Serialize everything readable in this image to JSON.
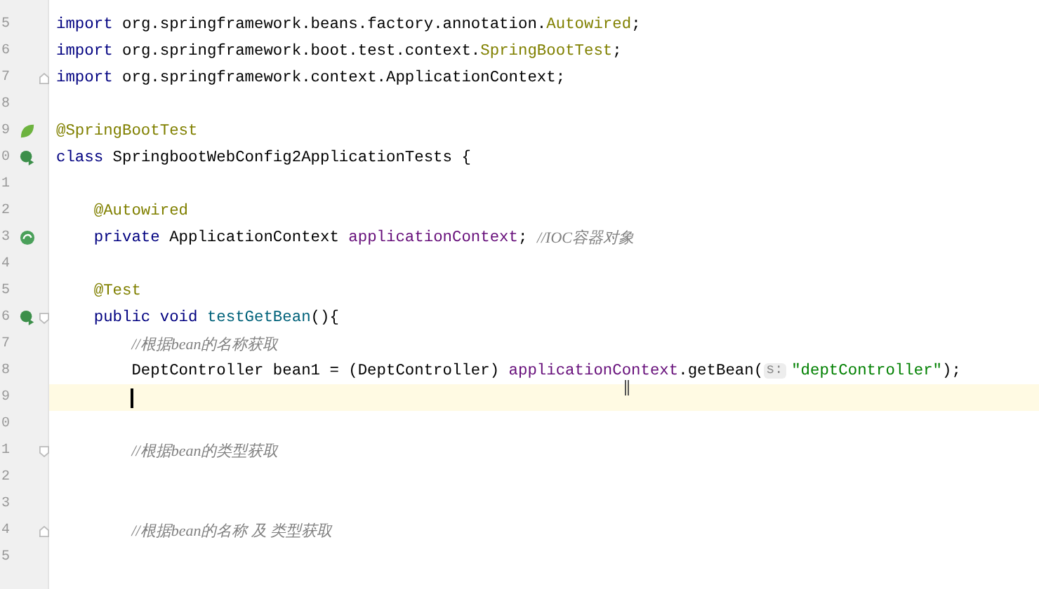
{
  "editor": {
    "lines": [
      {
        "number": "5",
        "tokens": [
          {
            "kind": "keyword",
            "text": "import"
          },
          {
            "kind": "plain",
            "text": " org.springframework.beans.factory.annotation."
          },
          {
            "kind": "annotation",
            "text": "Autowired"
          },
          {
            "kind": "plain",
            "text": ";"
          }
        ]
      },
      {
        "number": "6",
        "tokens": [
          {
            "kind": "keyword",
            "text": "import"
          },
          {
            "kind": "plain",
            "text": " org.springframework.boot.test.context."
          },
          {
            "kind": "annotation",
            "text": "SpringBootTest"
          },
          {
            "kind": "plain",
            "text": ";"
          }
        ]
      },
      {
        "number": "7",
        "fold": {
          "kind": "end"
        },
        "tokens": [
          {
            "kind": "keyword",
            "text": "import"
          },
          {
            "kind": "plain",
            "text": " org.springframework.context.ApplicationContext;"
          }
        ]
      },
      {
        "number": "8"
      },
      {
        "number": "9",
        "gutter_icon": {
          "kind": "leaf"
        },
        "tokens": [
          {
            "kind": "annotation",
            "text": "@SpringBootTest"
          }
        ]
      },
      {
        "number": "0",
        "gutter_icon": {
          "kind": "run"
        },
        "tokens": [
          {
            "kind": "keyword",
            "text": "class"
          },
          {
            "kind": "plain",
            "text": " SpringbootWebConfig2ApplicationTests {"
          }
        ]
      },
      {
        "number": "1"
      },
      {
        "number": "2",
        "tokens": [
          {
            "kind": "annotation",
            "text": "    @Autowired"
          }
        ]
      },
      {
        "number": "3",
        "gutter_icon": {
          "kind": "bean"
        },
        "tokens": [
          {
            "kind": "keyword",
            "text": "    private"
          },
          {
            "kind": "plain",
            "text": " ApplicationContext "
          },
          {
            "kind": "field",
            "text": "applicationContext"
          },
          {
            "kind": "plain",
            "text": "; "
          },
          {
            "kind": "comment",
            "text": "//IOC容器对象"
          }
        ]
      },
      {
        "number": "4"
      },
      {
        "number": "5",
        "tokens": [
          {
            "kind": "annotation",
            "text": "    @Test"
          }
        ]
      },
      {
        "number": "6",
        "gutter_icon": {
          "kind": "run"
        },
        "fold": {
          "kind": "start"
        },
        "tokens": [
          {
            "kind": "keyword",
            "text": "    public void "
          },
          {
            "kind": "method",
            "text": "testGetBean"
          },
          {
            "kind": "plain",
            "text": "(){"
          }
        ]
      },
      {
        "number": "7",
        "tokens": [
          {
            "kind": "comment",
            "text": "        //根据bean的名称获取"
          }
        ]
      },
      {
        "number": "8",
        "tokens": [
          {
            "kind": "plain",
            "text": "        DeptController bean1 = (DeptController) "
          },
          {
            "kind": "field",
            "text": "applicationContext"
          },
          {
            "kind": "plain",
            "text": ".getBean("
          },
          {
            "kind": "hint",
            "text": "s:"
          },
          {
            "kind": "string",
            "text": "\"deptController\""
          },
          {
            "kind": "plain",
            "text": ");"
          }
        ]
      },
      {
        "number": "9",
        "current": true,
        "caret": true
      },
      {
        "number": "0"
      },
      {
        "number": "1",
        "fold": {
          "kind": "start"
        },
        "tokens": [
          {
            "kind": "comment",
            "text": "        //根据bean的类型获取"
          }
        ]
      },
      {
        "number": "2"
      },
      {
        "number": "3"
      },
      {
        "number": "4",
        "fold": {
          "kind": "end"
        },
        "tokens": [
          {
            "kind": "comment",
            "text": "        //根据bean的名称 及 类型获取"
          }
        ]
      },
      {
        "number": "5"
      }
    ]
  }
}
